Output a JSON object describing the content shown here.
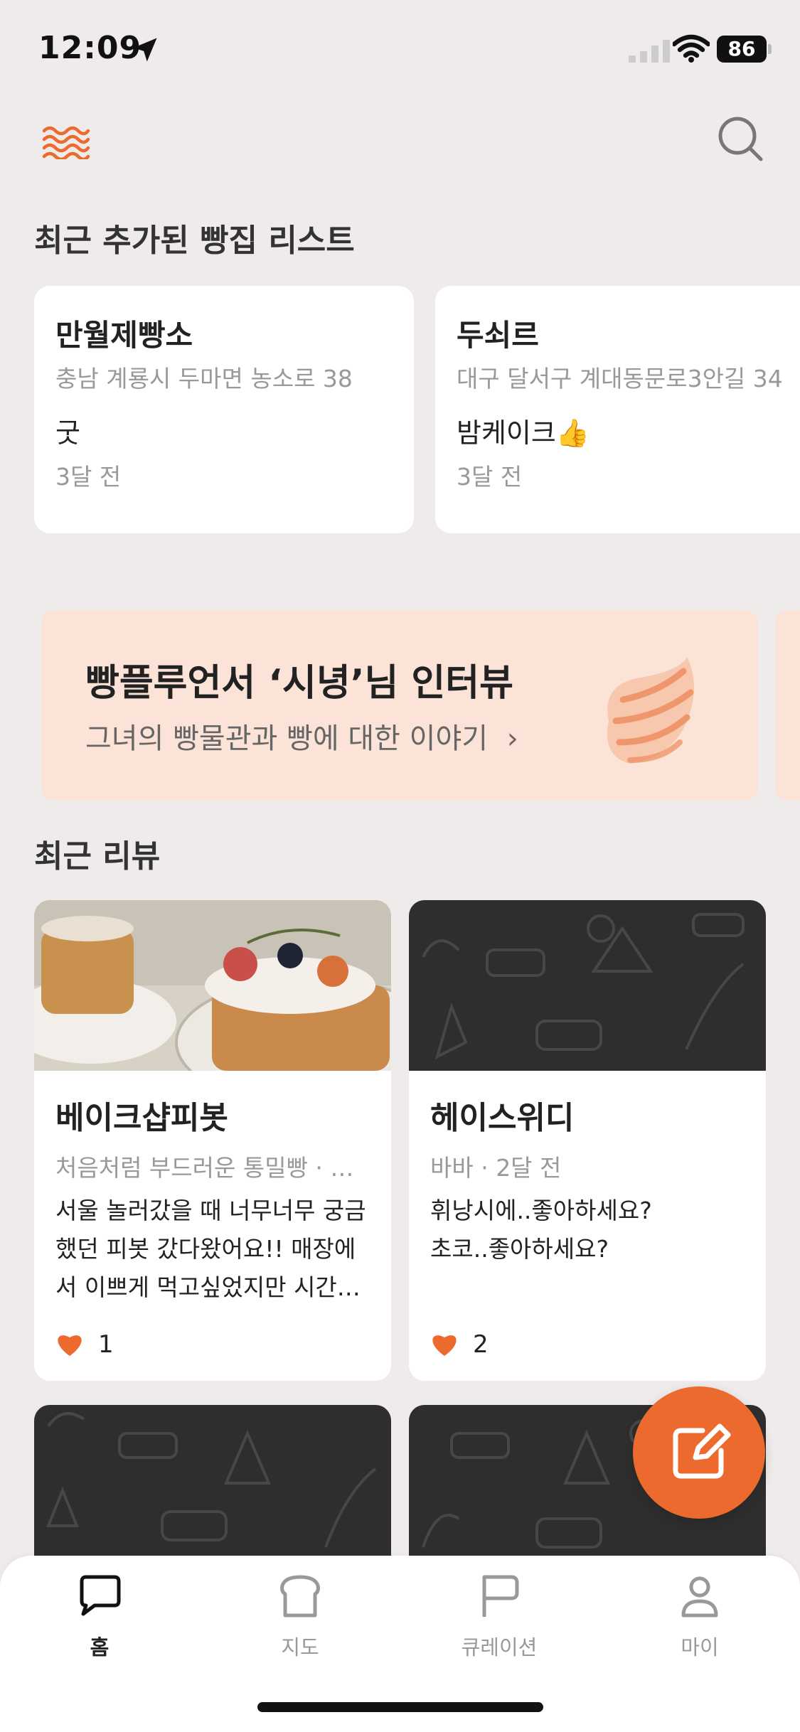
{
  "status_bar": {
    "time": "12:09",
    "battery": "86"
  },
  "header": {
    "logo_icon": "wave-logo-icon",
    "search_icon": "search-icon"
  },
  "recent_bakeries": {
    "title": "최근 추가된 빵집 리스트",
    "items": [
      {
        "name": "만월제빵소",
        "address": "충남 계룡시 두마면 농소로 38",
        "comment": "굿",
        "time": "3달 전"
      },
      {
        "name": "두쇠르",
        "address": "대구 달서구 계대동문로3안길 34",
        "comment": "밤케이크👍",
        "time": "3달 전"
      }
    ]
  },
  "banner": {
    "title": "빵플루언서 ‘시녕’님 인터뷰",
    "subtitle": "그녀의 빵물관과 빵에 대한 이야기",
    "chevron": "›"
  },
  "recent_reviews": {
    "title": "최근 리뷰",
    "items": [
      {
        "name": "베이크샵피봇",
        "meta": "처음처럼 부드러운 통밀빵 · …",
        "text": "서울 놀러갔을 때 너무너무 궁금했던 피봇 갔다왔어요!! 매장에서 이쁘게 먹고싶었지만 시간…",
        "likes": "1"
      },
      {
        "name": "헤이스위디",
        "meta": "바바 · 2달 전",
        "text": "휘낭시에..좋아하세요?\n초코..좋아하세요?",
        "likes": "2"
      }
    ]
  },
  "tabs": [
    {
      "label": "홈",
      "icon": "speech-bubble-icon",
      "active": true
    },
    {
      "label": "지도",
      "icon": "bread-icon",
      "active": false
    },
    {
      "label": "큐레이션",
      "icon": "flag-icon",
      "active": false
    },
    {
      "label": "마이",
      "icon": "person-icon",
      "active": false
    }
  ],
  "colors": {
    "accent": "#EC6A2E",
    "background": "#EEEBEA",
    "banner": "#FBE3D8",
    "dark_card": "#2E2E2E"
  }
}
